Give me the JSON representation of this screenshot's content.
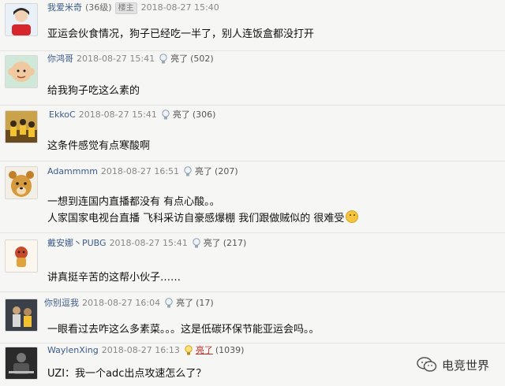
{
  "comments": [
    {
      "user": "我爱米奇",
      "count": "(36级)",
      "badge": "楼主",
      "time": "2018-08-27 15:40",
      "text": [
        "亚运会伙食情况，狗子已经吃一半了，别人连饭盒都没打开"
      ]
    },
    {
      "user": "你鸿哥",
      "time": "2018-08-27 15:41",
      "light": "亮了",
      "light_count": "(502)",
      "text": [
        "给我狗子吃这么素的"
      ]
    },
    {
      "user": "EkkoC",
      "time": "2018-08-27 15:41",
      "light": "亮了",
      "light_count": "(306)",
      "text": [
        "这条件感觉有点寒酸啊"
      ]
    },
    {
      "user": "Adammmm",
      "time": "2018-08-27 16:51",
      "light": "亮了",
      "light_count": "(207)",
      "text": [
        "一想到连国内直播都没有 有点心酸。。",
        "人家国家电视台直播 飞科采访自豪感爆棚 我们跟做贼似的 很难受"
      ]
    },
    {
      "user": "戴安娜丶PUBG",
      "time": "2018-08-27 15:41",
      "light": "亮了",
      "light_count": "(217)",
      "text": [
        "讲真挺辛苦的这帮小伙子……"
      ]
    },
    {
      "user": "你别逗我",
      "time": "2018-08-27 16:04",
      "light": "亮了",
      "light_count": "(17)",
      "text": [
        "一眼看过去咋这么多素菜。。。这是低碳环保节能亚运会吗。。"
      ]
    },
    {
      "user": "WaylenXing",
      "time": "2018-08-27 16:13",
      "light": "亮了",
      "light_count": "(1039)",
      "text": [
        "UZI：我一个adc出点攻速怎么了？"
      ]
    }
  ],
  "watermark": {
    "label": "电竞世界"
  },
  "colors": {
    "username": "#3b5b8a",
    "lit": "#c0302a",
    "background": "#f6f6f4"
  }
}
